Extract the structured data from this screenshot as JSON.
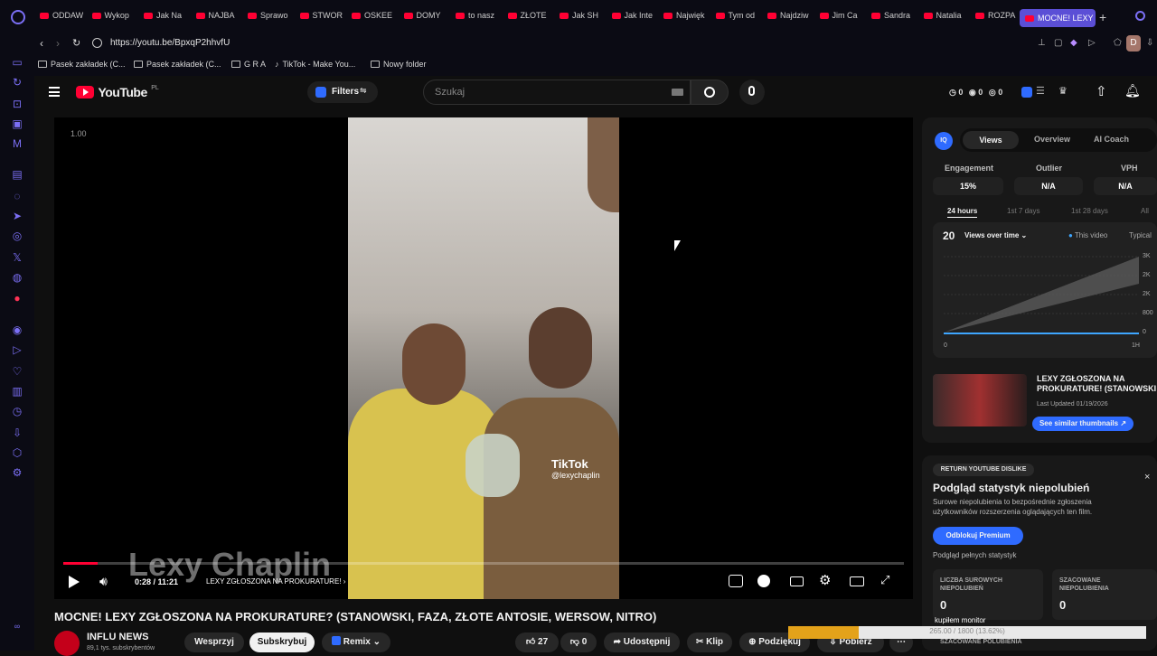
{
  "browser": {
    "tabs": [
      "ODDAW",
      "Wykop",
      "Jak Na",
      "NAJBA",
      "Sprawo",
      "STWOR",
      "OSKEE",
      "DOMY",
      "to nasz",
      "ZŁOTE",
      "Jak SH",
      "Jak Inte",
      "Najwięk",
      "Tym od",
      "Najdziw",
      "Jim Ca",
      "Sandra",
      "Natalia",
      "ROZPA",
      "MOCNE! LEXY"
    ],
    "url": "https://youtu.be/BpxqP2hhvfU",
    "bookmarks": [
      "Pasek zakładek (C...",
      "Pasek zakładek (C...",
      "G R A",
      "TikTok - Make You...",
      "Nowy folder"
    ],
    "profile_initial": "D"
  },
  "youtube": {
    "logo": "YouTube",
    "logo_region": "PL",
    "filters": "Filters",
    "search_placeholder": "Szukaj",
    "counters": [
      "0",
      "0",
      "0"
    ]
  },
  "player": {
    "speed": "1.00",
    "time": "0:28 / 11:21",
    "chapter": "LEXY ZGŁOSZONA NA PROKURATURE!",
    "progress": 0.041,
    "watermark": "Lexy Chaplin",
    "tiktok": "TikTok",
    "tiktok_handle": "@lexychaplin"
  },
  "video": {
    "title": "MOCNE! LEXY ZGŁOSZONA NA PROKURATURE? (STANOWSKI, FAZA, ZŁOTE ANTOSIE, WERSOW, NITRO)",
    "channel": "INFLU NEWS",
    "subs": "89,1 tys. subskrybentów",
    "support": "Wesprzyj",
    "subscribe": "Subskrybuj",
    "remix": "Remix",
    "likes": "27",
    "dislikes": "0",
    "share": "Udostępnij",
    "clip": "Klip",
    "thanks": "Podziękuj",
    "download": "Pobierz"
  },
  "vidiq": {
    "tabs": [
      "Views",
      "Overview",
      "AI Coach"
    ],
    "metrics": [
      {
        "label": "Engagement",
        "value": "15%"
      },
      {
        "label": "Outlier",
        "value": "N/A"
      },
      {
        "label": "VPH",
        "value": "N/A"
      }
    ],
    "ranges": [
      "24 hours",
      "1st 7 days",
      "1st 28 days",
      "All"
    ],
    "views_count": "20",
    "views_label": "Views over time",
    "legend_this": "This video",
    "legend_typical": "Typical",
    "y_ticks": [
      "3K",
      "2K",
      "2K",
      "800",
      "0"
    ],
    "x_ticks": [
      "0",
      "1H"
    ],
    "thumb_title": "LEXY ZGŁOSZONA NA PROKURATURE! (STANOWSKI",
    "thumb_date": "Last Updated 01/19/2026",
    "similar": "See similar thumbnails"
  },
  "ryd": {
    "badge": "RETURN YOUTUBE DISLIKE",
    "title": "Podgląd statystyk niepolubień",
    "desc": "Surowe niepolubienia to bezpośrednie zgłoszenia użytkowników rozszerzenia oglądających ten film.",
    "unlock": "Odblokuj Premium",
    "preview": "Podgląd pełnych statystyk",
    "raw_label": "LICZBA SUROWYCH NIEPOLUBIEŃ",
    "raw_value": "0",
    "est_label": "SZACOWANE NIEPOLUBIENIA",
    "est_value": "0",
    "est_likes": "SZACOWANE POLUBIENIA",
    "monitor": "kupiłem monitor",
    "overlay": "265.00 / 1800 (13.62%)"
  }
}
